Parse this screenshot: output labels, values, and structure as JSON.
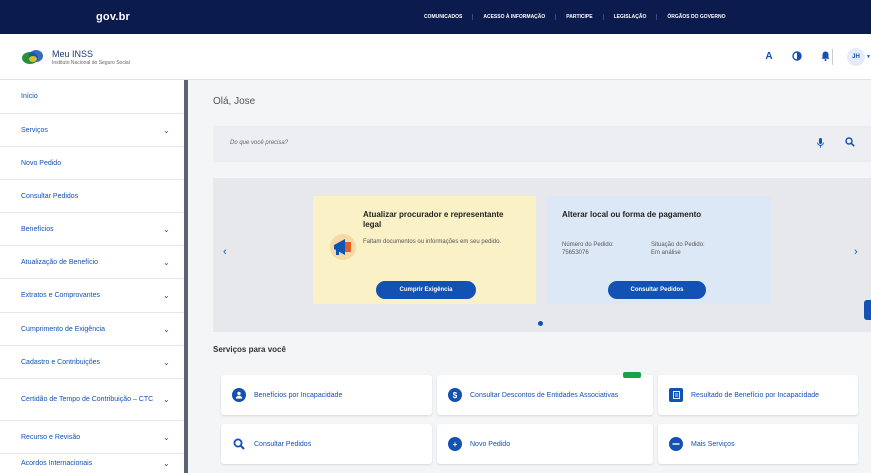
{
  "govbar": {
    "logo": "gov.br",
    "links": [
      "Comunicados",
      "Acesso à informação",
      "Participe",
      "Legislação",
      "Órgãos do governo"
    ]
  },
  "header": {
    "brand_name": "Meu INSS",
    "brand_sub": "Instituto Nacional do Seguro Social",
    "avatar_initials": "JH"
  },
  "sidebar": {
    "items": [
      {
        "label": "Início",
        "expandable": false
      },
      {
        "label": "Serviços",
        "expandable": true
      },
      {
        "label": "Novo Pedido",
        "expandable": false
      },
      {
        "label": "Consultar Pedidos",
        "expandable": false
      },
      {
        "label": "Benefícios",
        "expandable": true
      },
      {
        "label": "Atualização de Benefício",
        "expandable": true
      },
      {
        "label": "Extratos e Comprovantes",
        "expandable": true
      },
      {
        "label": "Cumprimento de Exigência",
        "expandable": true
      },
      {
        "label": "Cadastro e Contribuições",
        "expandable": true
      },
      {
        "label": "Certidão de Tempo de Contribuição – CTC",
        "expandable": true
      },
      {
        "label": "Recurso e Revisão",
        "expandable": true
      },
      {
        "label": "Acordos Internacionais",
        "expandable": true
      }
    ]
  },
  "main": {
    "greeting": "Olá, Jose",
    "search_placeholder": "Do que você precisa?",
    "card_a": {
      "title": "Atualizar procurador e representante legal",
      "text": "Faltam documentos ou informações em seu pedido.",
      "button": "Cumprir Exigência"
    },
    "card_b": {
      "title": "Alterar local ou forma de pagamento",
      "k1": "Número do Pedido:",
      "v1": "75653076",
      "k2": "Situação do Pedido:",
      "v2": "Em análise",
      "button": "Consultar Pedidos"
    },
    "section_title": "Serviços para você",
    "services": [
      {
        "label": "Benefícios por Incapacidade",
        "icon": "person-icon"
      },
      {
        "label": "Consultar Descontos de Entidades Associativas",
        "icon": "money-icon",
        "badge": true
      },
      {
        "label": "Resultado de Benefício por Incapacidade",
        "icon": "document-icon"
      },
      {
        "label": "Consultar Pedidos",
        "icon": "search-icon"
      },
      {
        "label": "Novo Pedido",
        "icon": "plus-icon"
      },
      {
        "label": "Mais Serviços",
        "icon": "more-icon"
      }
    ]
  },
  "colors": {
    "govbar": "#0c1b4d",
    "primary": "#1351b4",
    "card_yellow": "#fbf1c7",
    "card_blue": "#dde8f6",
    "badge_green": "#17a34a"
  }
}
